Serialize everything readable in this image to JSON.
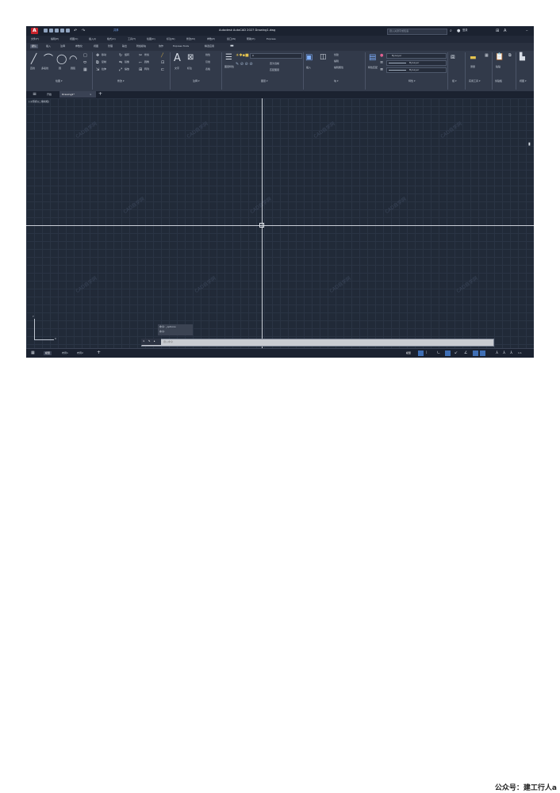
{
  "window": {
    "title": "Autodesk AutoCAD 2027 Drawing1.dwg",
    "qat_share": "共享",
    "search_placeholder": "键入关键字或短语",
    "signin": "登录"
  },
  "menu": [
    "文件(F)",
    "编辑(E)",
    "视图(V)",
    "插入(I)",
    "格式(O)",
    "工具(T)",
    "绘图(D)",
    "标注(N)",
    "修改(M)",
    "参数(P)",
    "窗口(W)",
    "帮助(H)",
    "Express"
  ],
  "ribbon_tabs": [
    "默认",
    "插入",
    "注释",
    "参数化",
    "视图",
    "管理",
    "输出",
    "附加模块",
    "协作",
    "Express Tools",
    "精选应用"
  ],
  "panels": {
    "draw": {
      "title": "绘图 ▾",
      "buttons": [
        "直线",
        "多段线",
        "圆",
        "圆弧"
      ]
    },
    "modify": {
      "title": "修改 ▾",
      "buttons": [
        "移动",
        "旋转",
        "修剪",
        "复制",
        "镜像",
        "圆角",
        "拉伸",
        "缩放",
        "阵列"
      ]
    },
    "annotation": {
      "title": "注释 ▾",
      "buttons": [
        "文字",
        "标注",
        "线性",
        "引线",
        "表格"
      ]
    },
    "layers": {
      "title": "图层 ▾",
      "buttons": [
        "图层特性",
        "置为当前",
        "匹配图层"
      ]
    },
    "block": {
      "title": "块 ▾",
      "buttons": [
        "插入",
        "创建",
        "编辑",
        "编辑属性"
      ]
    },
    "properties": {
      "title": "特性 ▾",
      "values": [
        "ByLayer",
        "ByLayer",
        "ByLayer"
      ],
      "buttons": [
        "特性匹配"
      ]
    },
    "groups": {
      "title": "组 ▾"
    },
    "utilities": {
      "title": "实用工具 ▾",
      "buttons": [
        "测量"
      ]
    },
    "clipboard": {
      "title": "剪贴板",
      "buttons": [
        "粘贴"
      ]
    },
    "view": {
      "title": "视图 ▾"
    }
  },
  "file_tabs": {
    "start": "开始",
    "drawing": "Drawing1*"
  },
  "viewport_label": "[-][俯视][二维线框]",
  "command": {
    "history": [
      "命令: _options",
      "命令:"
    ],
    "placeholder": "键入命令"
  },
  "status": {
    "layout_tabs": [
      "模型",
      "布局1",
      "布局2"
    ],
    "model_label": "模型",
    "scale": "1:1"
  },
  "watermark": "CAD自学网",
  "footer": "公众号：建工行人a"
}
